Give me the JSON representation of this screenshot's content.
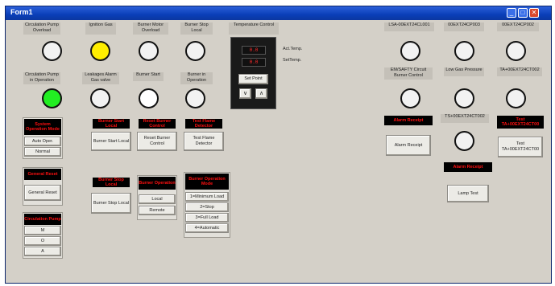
{
  "window": {
    "title": "Form1",
    "controls": {
      "minimize": "_",
      "maximize": "□",
      "close": "✕"
    }
  },
  "indicators_top": [
    {
      "label": "Circulation Pump Overload",
      "color": "white"
    },
    {
      "label": "Ignition Gas",
      "color": "yellow"
    },
    {
      "label": "Burner Motor Overload",
      "color": "white"
    },
    {
      "label": "Burner Stop Local",
      "color": "white"
    }
  ],
  "indicators_second": [
    {
      "label": "Circulation Pump in Operation",
      "color": "green"
    },
    {
      "label": "Leakages Alarm Gas valve",
      "color": "white"
    },
    {
      "label": "Burner Start",
      "color": "bright-white"
    },
    {
      "label": "Burner in Operation",
      "color": "white"
    }
  ],
  "temperature": {
    "label": "Temperature Control",
    "act_value": "0.0",
    "set_value": "0.0",
    "act_label": "Act.Temp.",
    "set_label": "SetTemp.",
    "setpoint_button": "Set Point",
    "down_arrow": "∨",
    "up_arrow": "∧"
  },
  "indicators_right_top": [
    {
      "label": "LSA-00EXT24CL001"
    },
    {
      "label": "00EXT24CP003"
    },
    {
      "label": "00EXT24CP002"
    }
  ],
  "indicators_right_second": [
    {
      "label": "EM/SAFTY Circuit Burner Control"
    },
    {
      "label": "Low Gas Pressure"
    },
    {
      "label": "TA+00EXT24CT002"
    }
  ],
  "system_mode": {
    "header": "System Operation Mode",
    "buttons": [
      "Auto Oper.",
      "Normal"
    ]
  },
  "general_reset": {
    "header": "General Reset",
    "button": "General Reset"
  },
  "circulation_pump": {
    "header": "Circulation Pump",
    "buttons": [
      "M",
      "O",
      "A"
    ]
  },
  "burner_start_local": {
    "header": "Burner Start Local",
    "button": "Burner Start Local"
  },
  "reset_burner_control": {
    "header": "Reset Burner Control",
    "button": "Reset Burner Control"
  },
  "test_flame": {
    "header": "Test Flame Detector",
    "button": "Test Flame Detector"
  },
  "burner_stop_local": {
    "header": "Burner Stop Local",
    "button": "Burner Stop Local"
  },
  "burner_operation": {
    "header": "Burner Operation",
    "buttons": [
      "Local",
      "Remote"
    ]
  },
  "burner_operation_mode": {
    "header": "Burner Operation Mode",
    "buttons": [
      "1=Minimum Load",
      "2=Stop",
      "3=Full Load",
      "4=Automatic"
    ]
  },
  "alarm_receipt": {
    "header": "Alarm Receipt",
    "button": "Alarm Receipt"
  },
  "ts_indicator": {
    "label": "TS+00EXT24CT002"
  },
  "test_ta": {
    "header": "Test TA+00EXT24CT00",
    "button": "Test TA+00EXT24CT00"
  },
  "lamp_test": {
    "header": "Alarm Receipt",
    "button": "Lamp Test"
  }
}
